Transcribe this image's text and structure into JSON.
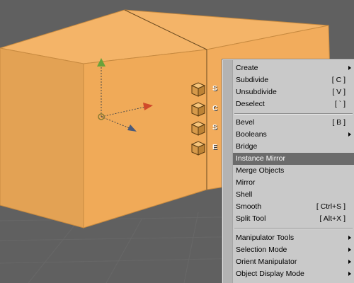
{
  "hotbox": {
    "labels": [
      "S",
      "C",
      "S",
      "E"
    ]
  },
  "menu": {
    "items": [
      {
        "label": "Create",
        "shortcut": "",
        "submenu": true
      },
      {
        "label": "Subdivide",
        "shortcut": "[ C ]",
        "submenu": false
      },
      {
        "label": "Unsubdivide",
        "shortcut": "[ V ]",
        "submenu": false
      },
      {
        "label": "Deselect",
        "shortcut": "[ ` ]",
        "submenu": false
      },
      {
        "label": "Bevel",
        "shortcut": "[ B ]",
        "submenu": false
      },
      {
        "label": "Booleans",
        "shortcut": "",
        "submenu": true
      },
      {
        "label": "Bridge",
        "shortcut": "",
        "submenu": false
      },
      {
        "label": "Instance Mirror",
        "shortcut": "",
        "submenu": false,
        "highlighted": true
      },
      {
        "label": "Merge Objects",
        "shortcut": "",
        "submenu": false
      },
      {
        "label": "Mirror",
        "shortcut": "",
        "submenu": false
      },
      {
        "label": "Shell",
        "shortcut": "",
        "submenu": false
      },
      {
        "label": "Smooth",
        "shortcut": "[ Ctrl+S ]",
        "submenu": false
      },
      {
        "label": "Split Tool",
        "shortcut": "[ Alt+X ]",
        "submenu": false
      },
      {
        "label": "Manipulator Tools",
        "shortcut": "",
        "submenu": true
      },
      {
        "label": "Selection Mode",
        "shortcut": "",
        "submenu": true
      },
      {
        "label": "Orient Manipulator",
        "shortcut": "",
        "submenu": true
      },
      {
        "label": "Object Display Mode",
        "shortcut": "",
        "submenu": true
      }
    ]
  },
  "colors": {
    "background": "#606060",
    "cube_front": "#f0aa58",
    "cube_side": "#e3a254",
    "cube_top": "#f4b468",
    "menu_bg": "#c9c9c9",
    "menu_highlight": "#6b6b6b"
  }
}
